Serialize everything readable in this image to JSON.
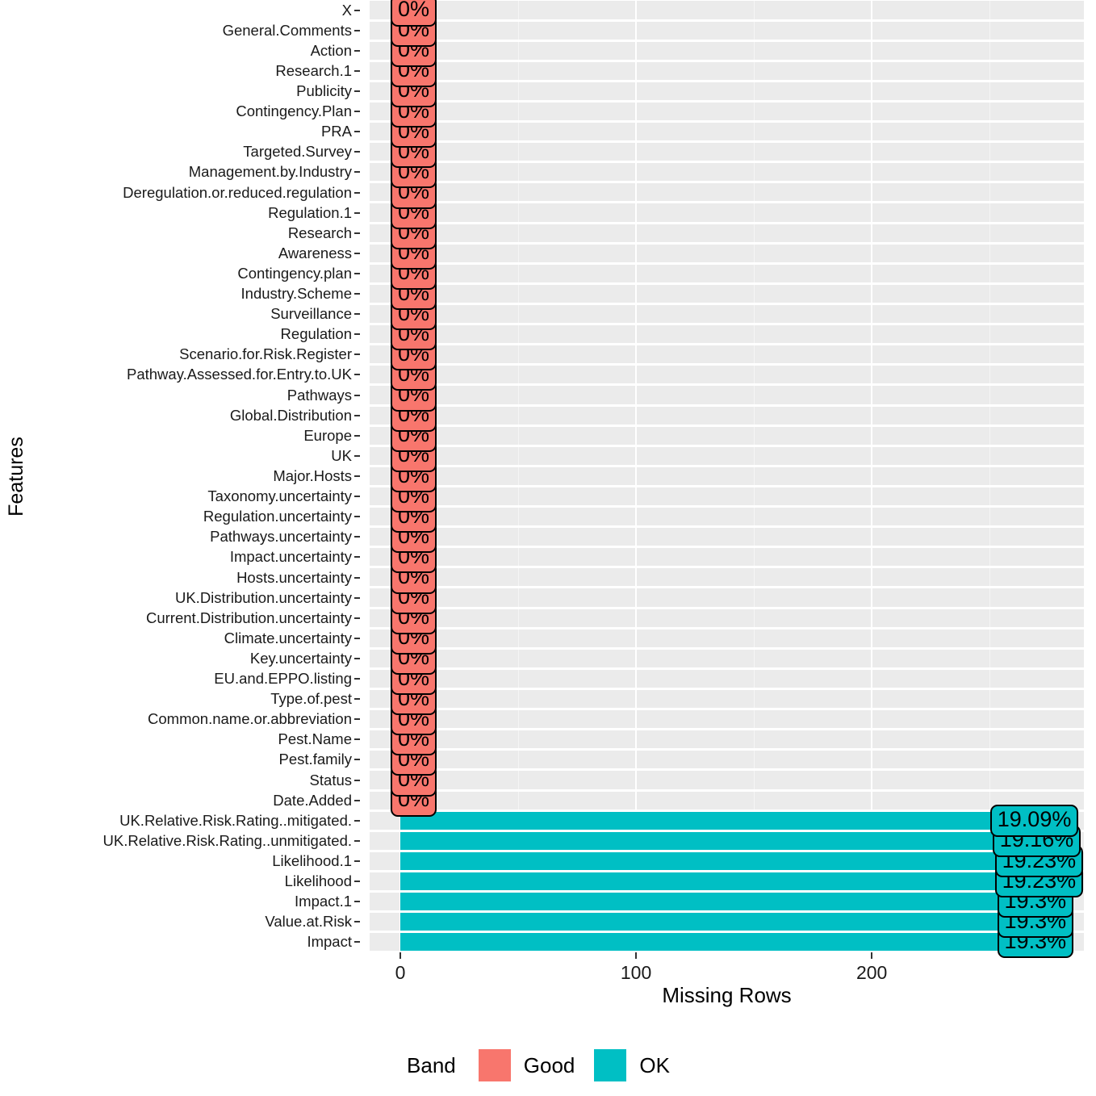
{
  "chart_data": {
    "type": "bar",
    "title": "",
    "xlabel": "Missing Rows",
    "ylabel": "Features",
    "orientation": "horizontal",
    "xlim": [
      -13,
      290
    ],
    "xticks": [
      0,
      100,
      200
    ],
    "xtick_labels": [
      "0",
      "100",
      "200"
    ],
    "grid": true,
    "legend": {
      "title": "Band",
      "position": "bottom",
      "entries": [
        {
          "label": "Good",
          "color": "#F8766D"
        },
        {
          "label": "OK",
          "color": "#00BFC4"
        }
      ]
    },
    "colors": {
      "good": "#F8766D",
      "ok": "#00BFC4",
      "panel": "#ebebeb",
      "grid": "#ffffff"
    },
    "categories": [
      "X",
      "General.Comments",
      "Action",
      "Research.1",
      "Publicity",
      "Contingency.Plan",
      "PRA",
      "Targeted.Survey",
      "Management.by.Industry",
      "Deregulation.or.reduced.regulation",
      "Regulation.1",
      "Research",
      "Awareness",
      "Contingency.plan",
      "Industry.Scheme",
      "Surveillance",
      "Regulation",
      "Scenario.for.Risk.Register",
      "Pathway.Assessed.for.Entry.to.UK",
      "Pathways",
      "Global.Distribution",
      "Europe",
      "UK",
      "Major.Hosts",
      "Taxonomy.uncertainty",
      "Regulation.uncertainty",
      "Pathways.uncertainty",
      "Impact.uncertainty",
      "Hosts.uncertainty",
      "UK.Distribution.uncertainty",
      "Current.Distribution.uncertainty",
      "Climate.uncertainty",
      "Key.uncertainty",
      "EU.and.EPPO.listing",
      "Type.of.pest",
      "Common.name.or.abbreviation",
      "Pest.Name",
      "Pest.family",
      "Status",
      "Date.Added",
      "UK.Relative.Risk.Rating..mitigated.",
      "UK.Relative.Risk.Rating..unmitigated.",
      "Likelihood.1",
      "Likelihood",
      "Impact.1",
      "Value.at.Risk",
      "Impact"
    ],
    "values": [
      0,
      0,
      0,
      0,
      0,
      0,
      0,
      0,
      0,
      0,
      0,
      0,
      0,
      0,
      0,
      0,
      0,
      0,
      0,
      0,
      0,
      0,
      0,
      0,
      0,
      0,
      0,
      0,
      0,
      0,
      0,
      0,
      0,
      0,
      0,
      0,
      0,
      0,
      0,
      0,
      255,
      256,
      257,
      257,
      258,
      258,
      258
    ],
    "point_labels": [
      "0%",
      "0%",
      "0%",
      "0%",
      "0%",
      "0%",
      "0%",
      "0%",
      "0%",
      "0%",
      "0%",
      "0%",
      "0%",
      "0%",
      "0%",
      "0%",
      "0%",
      "0%",
      "0%",
      "0%",
      "0%",
      "0%",
      "0%",
      "0%",
      "0%",
      "0%",
      "0%",
      "0%",
      "0%",
      "0%",
      "0%",
      "0%",
      "0%",
      "0%",
      "0%",
      "0%",
      "0%",
      "0%",
      "0%",
      "0%",
      "19.09%",
      "19.16%",
      "19.23%",
      "19.23%",
      "19.3%",
      "19.3%",
      "19.3%"
    ],
    "bands": [
      "Good",
      "Good",
      "Good",
      "Good",
      "Good",
      "Good",
      "Good",
      "Good",
      "Good",
      "Good",
      "Good",
      "Good",
      "Good",
      "Good",
      "Good",
      "Good",
      "Good",
      "Good",
      "Good",
      "Good",
      "Good",
      "Good",
      "Good",
      "Good",
      "Good",
      "Good",
      "Good",
      "Good",
      "Good",
      "Good",
      "Good",
      "Good",
      "Good",
      "Good",
      "Good",
      "Good",
      "Good",
      "Good",
      "Good",
      "Good",
      "OK",
      "OK",
      "OK",
      "OK",
      "OK",
      "OK",
      "OK"
    ]
  }
}
